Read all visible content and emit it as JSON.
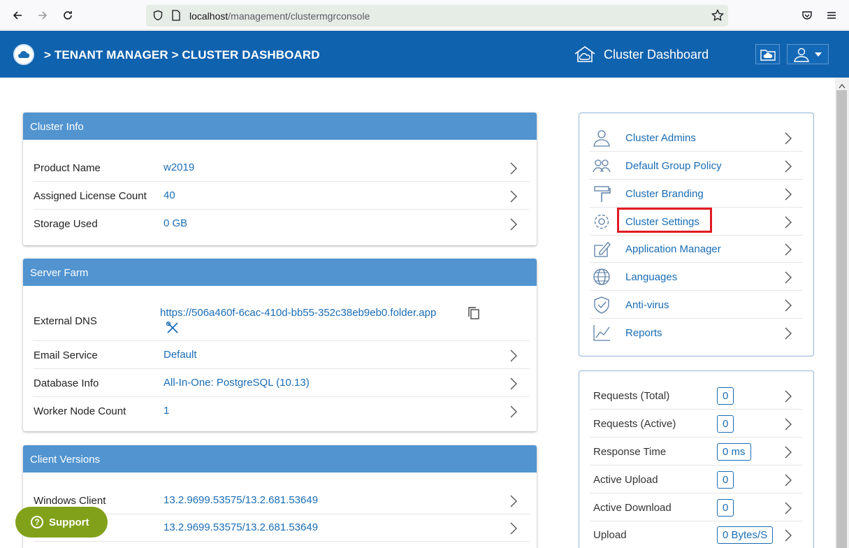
{
  "browser": {
    "url_host": "localhost",
    "url_path": "/management/clustermgrconsole"
  },
  "header": {
    "breadcrumb": "> TENANT MANAGER > CLUSTER DASHBOARD",
    "title": "Cluster Dashboard"
  },
  "cluster_info": {
    "title": "Cluster Info",
    "rows": [
      {
        "label": "Product Name",
        "value": "w2019"
      },
      {
        "label": "Assigned License Count",
        "value": "40"
      },
      {
        "label": "Storage Used",
        "value": "0 GB"
      }
    ]
  },
  "server_farm": {
    "title": "Server Farm",
    "external_dns_label": "External DNS",
    "external_dns_value": "https://506a460f-6cac-410d-bb55-352c38eb9eb0.folder.app",
    "rows": [
      {
        "label": "Email Service",
        "value": "Default"
      },
      {
        "label": "Database Info",
        "value": "All-In-One: PostgreSQL (10.13)"
      },
      {
        "label": "Worker Node Count",
        "value": "1"
      }
    ]
  },
  "client_versions": {
    "title": "Client Versions",
    "rows": [
      {
        "label": "Windows Client",
        "value": "13.2.9699.53575/13.2.681.53649"
      },
      {
        "label": "",
        "value": "13.2.9699.53575/13.2.681.53649"
      }
    ]
  },
  "menu": {
    "items": [
      {
        "label": "Cluster Admins",
        "icon": "admin-user-icon"
      },
      {
        "label": "Default Group Policy",
        "icon": "group-policy-icon"
      },
      {
        "label": "Cluster Branding",
        "icon": "paint-roller-icon"
      },
      {
        "label": "Cluster Settings",
        "icon": "gear-icon"
      },
      {
        "label": "Application Manager",
        "icon": "app-manager-icon"
      },
      {
        "label": "Languages",
        "icon": "globe-icon"
      },
      {
        "label": "Anti-virus",
        "icon": "shield-icon"
      },
      {
        "label": "Reports",
        "icon": "chart-icon"
      }
    ]
  },
  "stats": {
    "rows": [
      {
        "label": "Requests (Total)",
        "value": "0"
      },
      {
        "label": "Requests (Active)",
        "value": "0"
      },
      {
        "label": "Response Time",
        "value": "0 ms"
      },
      {
        "label": "Active Upload",
        "value": "0"
      },
      {
        "label": "Active Download",
        "value": "0"
      },
      {
        "label": "Upload",
        "value": "0 Bytes/S"
      }
    ]
  },
  "support": {
    "label": "Support"
  },
  "colors": {
    "header_bg": "#0f62ae",
    "panel_head": "#5194d0",
    "link": "#1a6db5",
    "highlight": "#e11b22",
    "support": "#82a11a"
  }
}
